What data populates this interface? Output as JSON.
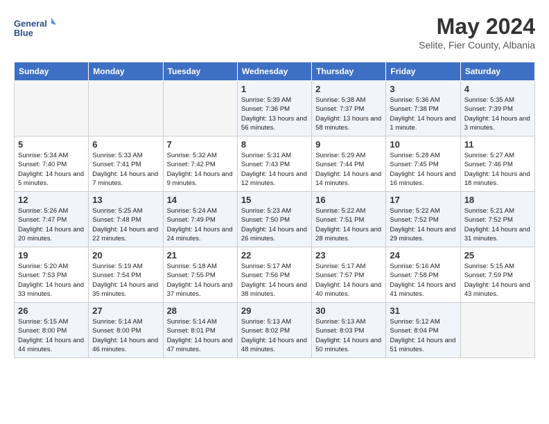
{
  "header": {
    "logo_line1": "General",
    "logo_line2": "Blue",
    "month_title": "May 2024",
    "location": "Selite, Fier County, Albania"
  },
  "days_of_week": [
    "Sunday",
    "Monday",
    "Tuesday",
    "Wednesday",
    "Thursday",
    "Friday",
    "Saturday"
  ],
  "weeks": [
    [
      {
        "day": "",
        "info": ""
      },
      {
        "day": "",
        "info": ""
      },
      {
        "day": "",
        "info": ""
      },
      {
        "day": "1",
        "info": "Sunrise: 5:39 AM\nSunset: 7:36 PM\nDaylight: 13 hours\nand 56 minutes."
      },
      {
        "day": "2",
        "info": "Sunrise: 5:38 AM\nSunset: 7:37 PM\nDaylight: 13 hours\nand 58 minutes."
      },
      {
        "day": "3",
        "info": "Sunrise: 5:36 AM\nSunset: 7:38 PM\nDaylight: 14 hours\nand 1 minute."
      },
      {
        "day": "4",
        "info": "Sunrise: 5:35 AM\nSunset: 7:39 PM\nDaylight: 14 hours\nand 3 minutes."
      }
    ],
    [
      {
        "day": "5",
        "info": "Sunrise: 5:34 AM\nSunset: 7:40 PM\nDaylight: 14 hours\nand 5 minutes."
      },
      {
        "day": "6",
        "info": "Sunrise: 5:33 AM\nSunset: 7:41 PM\nDaylight: 14 hours\nand 7 minutes."
      },
      {
        "day": "7",
        "info": "Sunrise: 5:32 AM\nSunset: 7:42 PM\nDaylight: 14 hours\nand 9 minutes."
      },
      {
        "day": "8",
        "info": "Sunrise: 5:31 AM\nSunset: 7:43 PM\nDaylight: 14 hours\nand 12 minutes."
      },
      {
        "day": "9",
        "info": "Sunrise: 5:29 AM\nSunset: 7:44 PM\nDaylight: 14 hours\nand 14 minutes."
      },
      {
        "day": "10",
        "info": "Sunrise: 5:28 AM\nSunset: 7:45 PM\nDaylight: 14 hours\nand 16 minutes."
      },
      {
        "day": "11",
        "info": "Sunrise: 5:27 AM\nSunset: 7:46 PM\nDaylight: 14 hours\nand 18 minutes."
      }
    ],
    [
      {
        "day": "12",
        "info": "Sunrise: 5:26 AM\nSunset: 7:47 PM\nDaylight: 14 hours\nand 20 minutes."
      },
      {
        "day": "13",
        "info": "Sunrise: 5:25 AM\nSunset: 7:48 PM\nDaylight: 14 hours\nand 22 minutes."
      },
      {
        "day": "14",
        "info": "Sunrise: 5:24 AM\nSunset: 7:49 PM\nDaylight: 14 hours\nand 24 minutes."
      },
      {
        "day": "15",
        "info": "Sunrise: 5:23 AM\nSunset: 7:50 PM\nDaylight: 14 hours\nand 26 minutes."
      },
      {
        "day": "16",
        "info": "Sunrise: 5:22 AM\nSunset: 7:51 PM\nDaylight: 14 hours\nand 28 minutes."
      },
      {
        "day": "17",
        "info": "Sunrise: 5:22 AM\nSunset: 7:52 PM\nDaylight: 14 hours\nand 29 minutes."
      },
      {
        "day": "18",
        "info": "Sunrise: 5:21 AM\nSunset: 7:52 PM\nDaylight: 14 hours\nand 31 minutes."
      }
    ],
    [
      {
        "day": "19",
        "info": "Sunrise: 5:20 AM\nSunset: 7:53 PM\nDaylight: 14 hours\nand 33 minutes."
      },
      {
        "day": "20",
        "info": "Sunrise: 5:19 AM\nSunset: 7:54 PM\nDaylight: 14 hours\nand 35 minutes."
      },
      {
        "day": "21",
        "info": "Sunrise: 5:18 AM\nSunset: 7:55 PM\nDaylight: 14 hours\nand 37 minutes."
      },
      {
        "day": "22",
        "info": "Sunrise: 5:17 AM\nSunset: 7:56 PM\nDaylight: 14 hours\nand 38 minutes."
      },
      {
        "day": "23",
        "info": "Sunrise: 5:17 AM\nSunset: 7:57 PM\nDaylight: 14 hours\nand 40 minutes."
      },
      {
        "day": "24",
        "info": "Sunrise: 5:16 AM\nSunset: 7:58 PM\nDaylight: 14 hours\nand 41 minutes."
      },
      {
        "day": "25",
        "info": "Sunrise: 5:15 AM\nSunset: 7:59 PM\nDaylight: 14 hours\nand 43 minutes."
      }
    ],
    [
      {
        "day": "26",
        "info": "Sunrise: 5:15 AM\nSunset: 8:00 PM\nDaylight: 14 hours\nand 44 minutes."
      },
      {
        "day": "27",
        "info": "Sunrise: 5:14 AM\nSunset: 8:00 PM\nDaylight: 14 hours\nand 46 minutes."
      },
      {
        "day": "28",
        "info": "Sunrise: 5:14 AM\nSunset: 8:01 PM\nDaylight: 14 hours\nand 47 minutes."
      },
      {
        "day": "29",
        "info": "Sunrise: 5:13 AM\nSunset: 8:02 PM\nDaylight: 14 hours\nand 48 minutes."
      },
      {
        "day": "30",
        "info": "Sunrise: 5:13 AM\nSunset: 8:03 PM\nDaylight: 14 hours\nand 50 minutes."
      },
      {
        "day": "31",
        "info": "Sunrise: 5:12 AM\nSunset: 8:04 PM\nDaylight: 14 hours\nand 51 minutes."
      },
      {
        "day": "",
        "info": ""
      }
    ]
  ]
}
